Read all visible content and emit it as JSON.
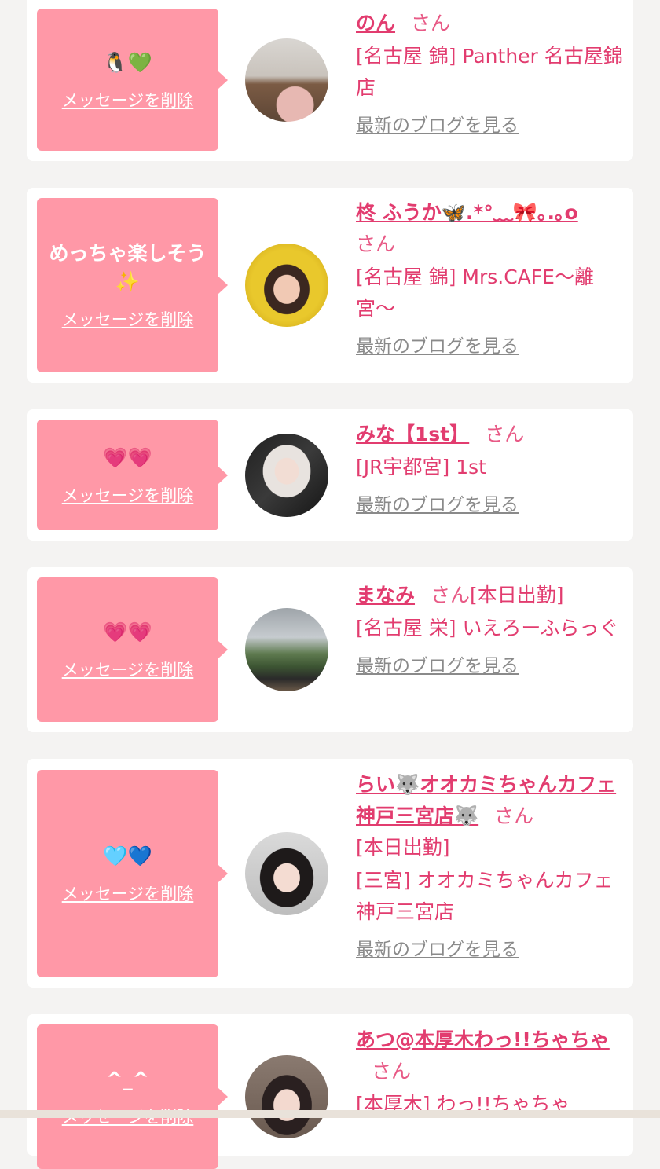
{
  "common": {
    "delete_label": "メッセージを削除",
    "blog_label": "最新のブログを見る"
  },
  "cards": [
    {
      "bubble_text": "🐧💚",
      "name": "のん",
      "suffix": "さん",
      "status": "",
      "shop": "[名古屋 錦] Panther 名古屋錦店"
    },
    {
      "bubble_text": "めっちゃ楽しそう✨",
      "name": "柊 ふうか🦋.*°﹏🎀｡.｡o",
      "suffix": "さん",
      "status": "",
      "shop": "[名古屋 錦] Mrs.CAFE〜離宮〜"
    },
    {
      "bubble_text": "💗💗",
      "name": "みな【1st】",
      "suffix": "さん",
      "status": "",
      "shop": "[JR宇都宮] 1st"
    },
    {
      "bubble_text": "💗💗",
      "name": "まなみ",
      "suffix": "さん",
      "status": "[本日出勤]",
      "shop": "[名古屋 栄] いえろーふらっぐ"
    },
    {
      "bubble_text": "🩵💙",
      "name": "らい🐺オオカミちゃんカフェ神戸三宮店🐺",
      "suffix": "さん",
      "status": "[本日出勤]",
      "shop": "[三宮] オオカミちゃんカフェ神戸三宮店"
    },
    {
      "bubble_text": "^_^",
      "name": "あつ@本厚木わっ!!ちゃちゃ",
      "suffix": "さん",
      "status": "",
      "shop": "[本厚木] わっ!!ちゃちゃ"
    }
  ]
}
